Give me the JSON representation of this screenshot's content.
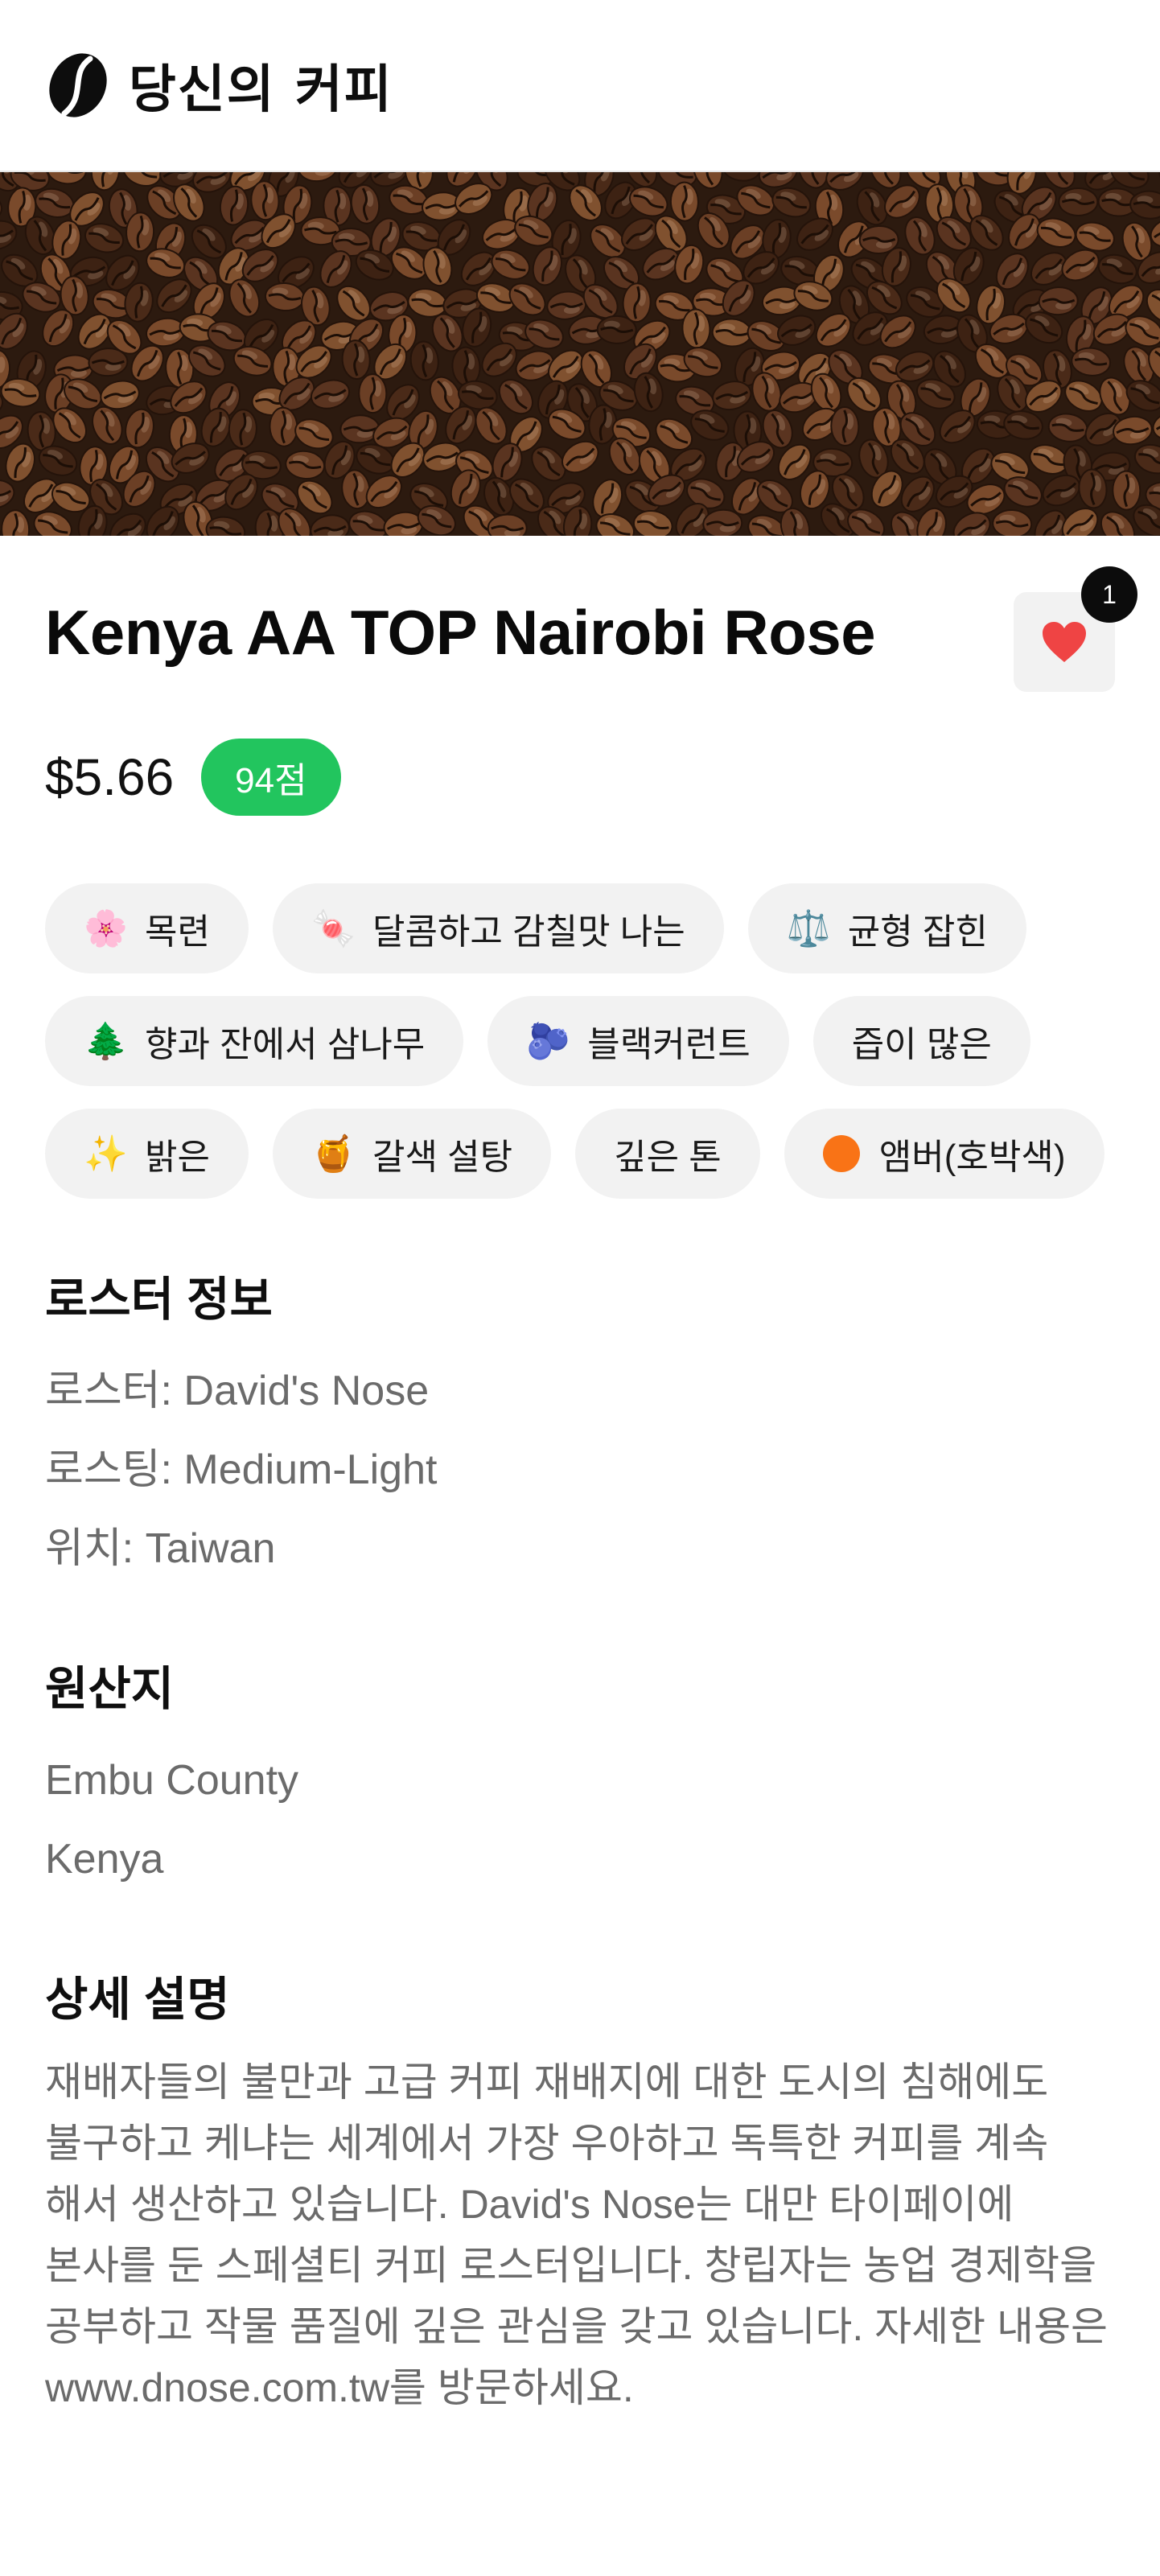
{
  "header": {
    "brand_title": "당신의 커피",
    "logo_icon": "coffee-bean-icon"
  },
  "hero": {
    "image": "coffee-beans-banner"
  },
  "product": {
    "title": "Kenya AA TOP Nairobi Rose",
    "price": "$5.66",
    "score": "94점",
    "favorite": {
      "icon": "heart-icon",
      "count": "1",
      "color": "#ef4444"
    }
  },
  "tags": [
    {
      "icon": "🌸",
      "icon_name": "cherry-blossom-icon",
      "label": "목련"
    },
    {
      "icon": "🍬",
      "icon_name": "candy-icon",
      "label": "달콤하고 감칠맛 나는"
    },
    {
      "icon": "⚖️",
      "icon_name": "balance-scale-icon",
      "label": "균형 잡힌"
    },
    {
      "icon": "🌲",
      "icon_name": "evergreen-tree-icon",
      "label": "향과 잔에서 삼나무"
    },
    {
      "icon": "🫐",
      "icon_name": "blueberries-icon",
      "label": "블랙커런트"
    },
    {
      "icon": "",
      "icon_name": "",
      "label": "즙이 많은"
    },
    {
      "icon": "✨",
      "icon_name": "sparkles-icon",
      "label": "밝은"
    },
    {
      "icon": "🍯",
      "icon_name": "honey-pot-icon",
      "label": "갈색 설탕"
    },
    {
      "icon": "",
      "icon_name": "",
      "label": "깊은 톤"
    },
    {
      "icon": "●",
      "icon_name": "orange-circle-icon",
      "label": "앰버(호박색)"
    }
  ],
  "roaster_info": {
    "title": "로스터 정보",
    "roaster": "로스터: David's Nose",
    "roasting": "로스팅: Medium-Light",
    "location": "위치: Taiwan"
  },
  "origin": {
    "title": "원산지",
    "region": "Embu County",
    "country": "Kenya"
  },
  "details": {
    "title": "상세 설명",
    "text": "재배자들의 불만과 고급 커피 재배지에 대한 도시의 침해에도 불구하고 케냐는 세계에서 가장 우아하고 독특한 커피를 계속 해서 생산하고 있습니다. David's Nose는 대만 타이페이에 본사를 둔 스페셜티 커피 로스터입니다. 창립자는 농업 경제학을 공부하고 작물 품질에 깊은 관심을 갖고 있습니다. 자세한 내용은 www.dnose.com.tw를 방문하세요."
  },
  "colors": {
    "score_badge": "#22c55e",
    "tag_background": "#f2f2f2",
    "muted_text": "#6b6b6b",
    "amber_dot": "#f97316"
  }
}
